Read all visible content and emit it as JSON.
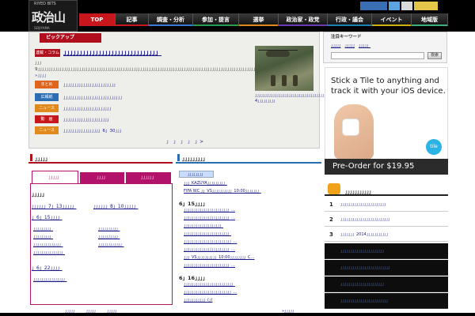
{
  "header": {
    "logo_mark": "政治山",
    "logo_tag": "RIYED BITS",
    "logo_sub": "SEIJIYAMA"
  },
  "nav": [
    {
      "label": "TOP",
      "active": true,
      "bar_color": "#c8161d"
    },
    {
      "label": "記事",
      "active": false,
      "bar_color": "#c8161d"
    },
    {
      "label": "調査・分析",
      "active": false,
      "bar_color": "#3a7bd5"
    },
    {
      "label": "参加・提言",
      "active": false,
      "bar_color": "#2a9d4a"
    },
    {
      "label": "選挙",
      "active": false,
      "bar_color": "#e08a1e"
    },
    {
      "label": "政治家・政党",
      "active": false,
      "bar_color": "#6a3ab0"
    },
    {
      "label": "行政・議会",
      "active": false,
      "bar_color": "#1e7fb0"
    },
    {
      "label": "イベント",
      "active": false,
      "bar_color": "#d0b010"
    },
    {
      "label": "地域版",
      "active": false,
      "bar_color": "#3ab07a"
    }
  ],
  "pickup": {
    "tab_label": "ピックアップ",
    "feature": {
      "badge": "連載・コラム",
      "title": "」」」」」」」」」」」」」」」」」」」」」」」」」」」」」」",
      "body": "」」」9」」」」」」」」」」」」」」」」」」」」」」」」」」」」」」」」」」」」」」」」」」」」」」」」」」」」」」」」」」」」」」」」」」」」」」」」」」」」」」」」」」」」」」」」」」」」」」」」」」」」」」」」」」」」」…",
      "more": "»」」」」",
      "image_caption": "」」」」」」」」」」」」」」」」」」」」」」」」」」」」」」」」」」」」」」」」」」」」」」」」」4」」」」」」」」」"
    },
    "categories": [
      {
        "label": "まとめ",
        "color": "#e0641e",
        "text": "」」」」」」」」」」」」」」」」」」」」」」」」"
      },
      {
        "label": "広報紙",
        "color": "#2a6db3",
        "text": "」」」」」」」」」」」」」」」」」」」」」」」」」」」"
      },
      {
        "label": "ニュース",
        "color": "#e08a1e",
        "text": "」」」」」」」」」」」」」」」」」」」」」」"
      },
      {
        "label": "動　画",
        "color": "#c8161d",
        "text": "」」」」」」」」」」」」」」」」」」」」」"
      },
      {
        "label": "ニュース",
        "color": "#e08a1e",
        "text": "」」」」」」」」」」」」」」」」」6」30」」」"
      }
    ],
    "pager": [
      "」",
      "」",
      "」",
      "」",
      "」>"
    ]
  },
  "keyword": {
    "title": "注目キーワード",
    "links": [
      "」」」」」",
      "」」」」」",
      "」」」」」"
    ],
    "button": "検索"
  },
  "ad": {
    "headline": "Stick a Tile to anything and track it with your iOS device.",
    "logo": "tile",
    "cta": "Pre-Order for $19.95"
  },
  "ranking": {
    "title": "」」」」」」」」」」」",
    "rows": [
      {
        "num": "1",
        "text": "」」」」」」」」」」」」」」」」」」」」」」」"
      },
      {
        "num": "2",
        "text": "」」」」」」」」」」」」」」」」」」」」」」」」」"
      },
      {
        "num": "3",
        "text": "」」」」」」」2014」」」」」」」」」」」"
      }
    ],
    "dark_rows": [
      {
        "num": "",
        "text": "」」」」」」」」」」」」」」」」」」」」」」"
      },
      {
        "num": "",
        "text": "」」」」」」」」」」」」」」」」」」」」」」」」」"
      },
      {
        "num": "",
        "text": "」」」」」」」」」」」」」」」」」」」」」」"
      },
      {
        "num": "",
        "text": "」」」」」」」」」」」」」」」」」」」」」」」」"
      }
    ]
  },
  "left": {
    "heading": "」」」」」",
    "tabs": [
      "」」」」」",
      "」」」」",
      "」」」」」」"
    ],
    "panel_title": "」」」」」",
    "top_links": [
      "」」」」」」7」13」」」」」",
      "」」」」」」8」10」」」」」"
    ],
    "date1": "」6」15」」」」",
    "grid1": [
      "」」」」」」」」」",
      "」」」」」」」」」」",
      "」」」」」」」」」",
      "」」」」」」」」」」",
      "」」」」」」」」」」」」」」",
      "」」」」」」」」」」」」",
      "」」」」」」」」」」」」」」」"
    ],
    "date2": "」6」22」」」」",
    "grid2": [
      "」」」」」」」」」」」」」」」」"
    ],
    "more": [
      "」」」」」",
      "」」」」」",
      "」」」」」"
    ]
  },
  "mid": {
    "heading": "」」」」」」」」」",
    "tag": "」」」」」」」」",
    "items_top": [
      "」」」KAZUYA」」」」」」」」」",
      "FIFA WC 」」VS」」」」」」」」」」10:00」」」」」」」"
    ],
    "date1": "6」15」」」」",
    "items1": [
      "」」」」」」」」」」」」」」」」」」」」」」」…",
      "」」」」」」」」」」」」」」」」」」」」」」」…",
      "」」」」」」」」」」」」」」」」」」」",
      "」」」」」」」」」」」」」」」」」」」」」」」",
      "」」」」」」」」」」」」」」」」」」」」」」」」…",
      "」」」」」」」」」」」」」」」」」」」」」」」…",
      "」」」VS」」」」」」」」」」10:00」」」」」」」」C…",
      "」」」」」」」」」」」」」」」」」」」」」」」…"
    ],
    "date2": "6」16」」」」",
    "items2": [
      "」」」」」」」」」」」」」」」」」」」」」」」」」",
      "」」」」」」」」」」」」」」」」」」」」」」」」…",
      "」」」」」」」」」」」(」)"
    ],
    "more": "»」」」」」"
  }
}
